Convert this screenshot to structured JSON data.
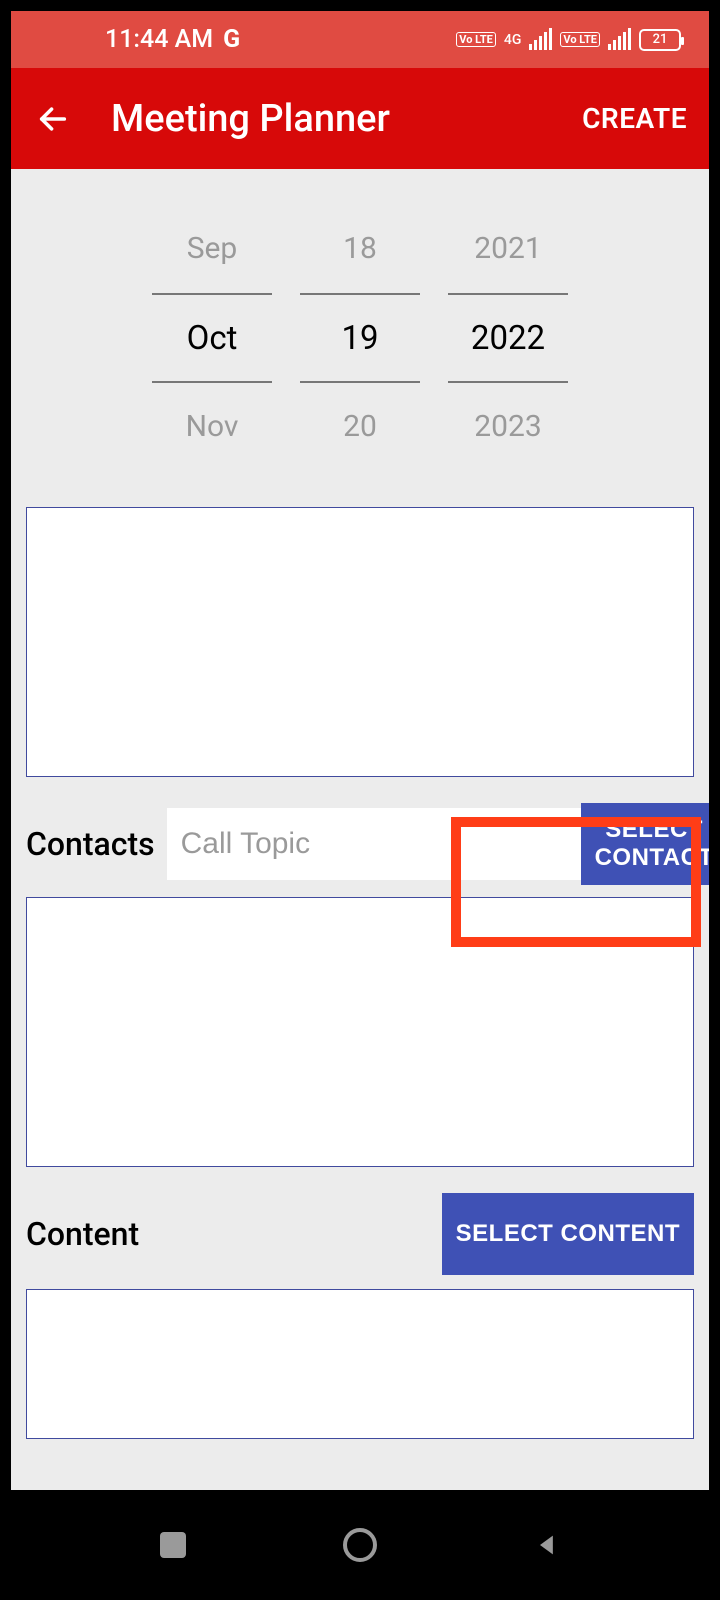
{
  "status": {
    "time": "11:44 AM",
    "g_indicator": "G",
    "network_label": "4G",
    "volte_label": "Vo LTE",
    "battery_text": "21"
  },
  "appbar": {
    "title": "Meeting Planner",
    "create_label": "CREATE"
  },
  "date_picker": {
    "month": {
      "prev": "Sep",
      "selected": "Oct",
      "next": "Nov"
    },
    "day": {
      "prev": "18",
      "selected": "19",
      "next": "20"
    },
    "year": {
      "prev": "2021",
      "selected": "2022",
      "next": "2023"
    }
  },
  "contacts": {
    "label": "Contacts",
    "input_placeholder": "Call Topic",
    "button_label": "SELECT CONTACT"
  },
  "content": {
    "label": "Content",
    "button_label": "SELECT CONTENT"
  }
}
